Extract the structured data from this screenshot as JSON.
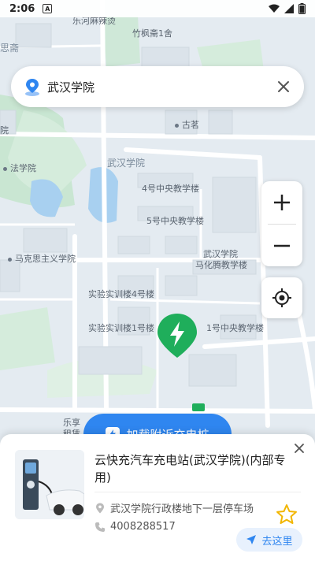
{
  "status_bar": {
    "time": "2:06",
    "notification_badge": "A"
  },
  "search": {
    "query": "武汉学院"
  },
  "map": {
    "labels": [
      {
        "id": "l1",
        "text": "乐河麻辣烫"
      },
      {
        "id": "l2",
        "text": "竹枫斋1舍"
      },
      {
        "id": "l3",
        "text": "思斋"
      },
      {
        "id": "l4",
        "text": "古茗"
      },
      {
        "id": "l5",
        "text": "院"
      },
      {
        "id": "l6",
        "text": "法学院"
      },
      {
        "id": "l7",
        "text": "武汉学院"
      },
      {
        "id": "l8",
        "text": "4号中央教学楼"
      },
      {
        "id": "l9",
        "text": "5号中央教学楼"
      },
      {
        "id": "l10",
        "text": "武汉学院"
      },
      {
        "id": "l11",
        "text": "马化腾教学楼"
      },
      {
        "id": "l12",
        "text": "马克思主义学院"
      },
      {
        "id": "l13",
        "text": "实验实训楼4号楼"
      },
      {
        "id": "l14",
        "text": "实验实训楼1号楼"
      },
      {
        "id": "l15",
        "text": "1号中央教学楼"
      },
      {
        "id": "l16",
        "text": "乐享"
      },
      {
        "id": "l17",
        "text": "租赁"
      }
    ]
  },
  "load_button": {
    "label": "加载附近充电桩"
  },
  "station": {
    "name": "云快充汽车充电站(武汉学院)(内部专用)",
    "address": "武汉学院行政楼地下一层停车场",
    "phone": "4008288517",
    "go_label": "去这里"
  },
  "colors": {
    "accent": "#2f86f0",
    "marker": "#1fae5b",
    "star": "#f2b600"
  }
}
